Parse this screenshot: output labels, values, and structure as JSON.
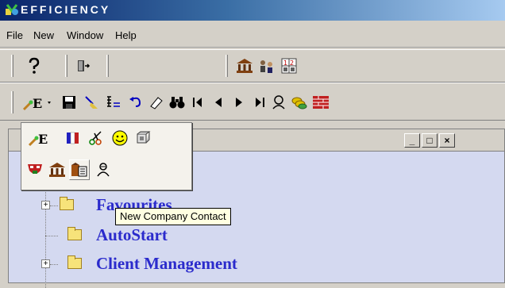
{
  "app": {
    "title": "EFFICIENCY"
  },
  "menu": {
    "items": [
      "File",
      "New",
      "Window",
      "Help"
    ]
  },
  "toolbar1": {
    "icons": [
      "help-icon",
      "exit-door-icon",
      "bank-icon",
      "people-icon",
      "calculator-icon"
    ]
  },
  "toolbar2": {
    "icons": [
      "new-entry-icon",
      "save-icon",
      "clean-icon",
      "list-icon",
      "undo-icon",
      "eraser-icon",
      "binoculars-icon",
      "first-record-icon",
      "previous-record-icon",
      "next-record-icon",
      "last-record-icon",
      "search-person-icon",
      "coins-icon",
      "brick-wall-icon"
    ]
  },
  "popup": {
    "icons": [
      "new-entry-icon",
      "flag-icon",
      "scissors-icon",
      "smiley-icon",
      "cube-icon",
      "mask-icon",
      "bank-icon",
      "company-contact-icon",
      "contact-person-icon"
    ]
  },
  "tooltip": {
    "text": "New Company Contact"
  },
  "window": {
    "buttons": [
      "_",
      "□",
      "×"
    ]
  },
  "tree": {
    "items": [
      {
        "label": "Favourites",
        "expandable": true
      },
      {
        "label": "AutoStart",
        "expandable": false
      },
      {
        "label": "Client Management",
        "expandable": true
      }
    ]
  },
  "colors": {
    "accent": "#2b2bcc",
    "titlebar": "#0a246a",
    "mdi_bg": "#d4d9f0",
    "tooltip_bg": "#ffffe1"
  }
}
